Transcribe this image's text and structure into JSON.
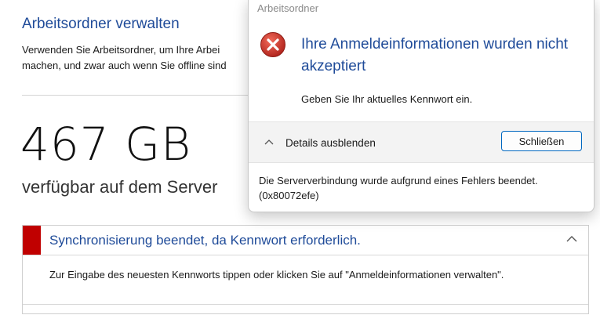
{
  "background": {
    "title": "Arbeitsordner verwalten",
    "description_line1": "Verwenden Sie Arbeitsordner, um Ihre Arbei",
    "description_line2": "machen, und zwar auch wenn Sie offline sind",
    "capacity_value": "467 GB",
    "capacity_label": "verfügbar auf dem Server"
  },
  "sync_panel": {
    "title": "Synchronisierung beendet, da Kennwort erforderlich.",
    "message": "Zur Eingabe des neuesten Kennworts tippen oder klicken Sie auf \"Anmeldeinformationen verwalten\".",
    "status_color": "#c00000",
    "chevron_icon": "chevron-up-icon"
  },
  "dialog": {
    "caption": "Arbeitsordner",
    "icon": "error-icon",
    "heading": "Ihre Anmeldeinformationen wurden nicht akzeptiert",
    "message": "Geben Sie Ihr aktuelles Kennwort ein.",
    "details_toggle_label": "Details ausblenden",
    "close_button_label": "Schließen",
    "details_line1": "Die Serververbindung wurde aufgrund eines Fehlers beendet.",
    "details_line2": "(0x80072efe)",
    "accent_color": "#0067c0",
    "error_color": "#c42b1c"
  }
}
